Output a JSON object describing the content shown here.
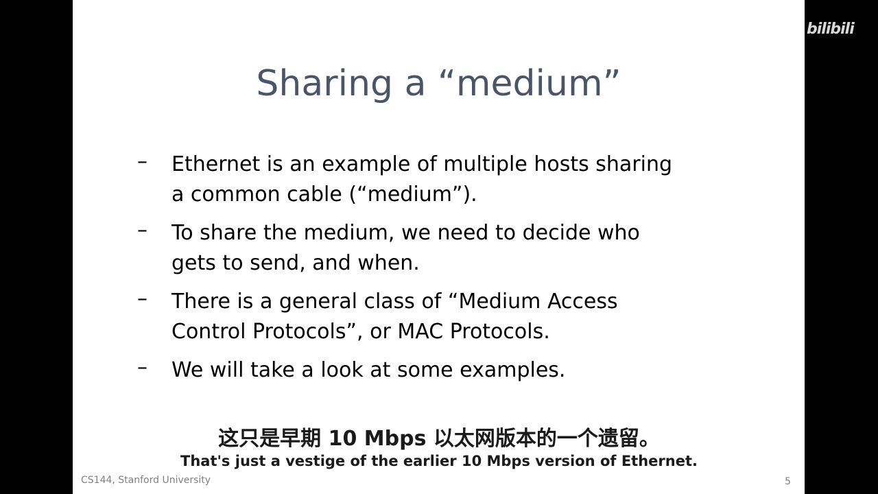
{
  "slide": {
    "title": "Sharing a “medium”",
    "bullets": [
      {
        "marker": "–",
        "line1": "Ethernet is an example of multiple hosts sharing",
        "line2": "a common cable (“medium”)."
      },
      {
        "marker": "–",
        "line1": "To share the medium, we need to decide who",
        "line2": "gets to send, and when."
      },
      {
        "marker": "–",
        "line1": "There is a general class of “Medium Access",
        "line2": "Control Protocols”, or MAC Protocols."
      },
      {
        "marker": "–",
        "line1": "We will take a look at some examples.",
        "line2": ""
      }
    ],
    "footer": "CS144, Stanford University",
    "page_number": "5"
  },
  "subtitles": {
    "zh": "这只是早期 10 Mbps 以太网版本的一个遗留。",
    "en": "That's just a vestige of the earlier 10 Mbps version of Ethernet."
  },
  "watermark": {
    "text": "bilibili"
  }
}
